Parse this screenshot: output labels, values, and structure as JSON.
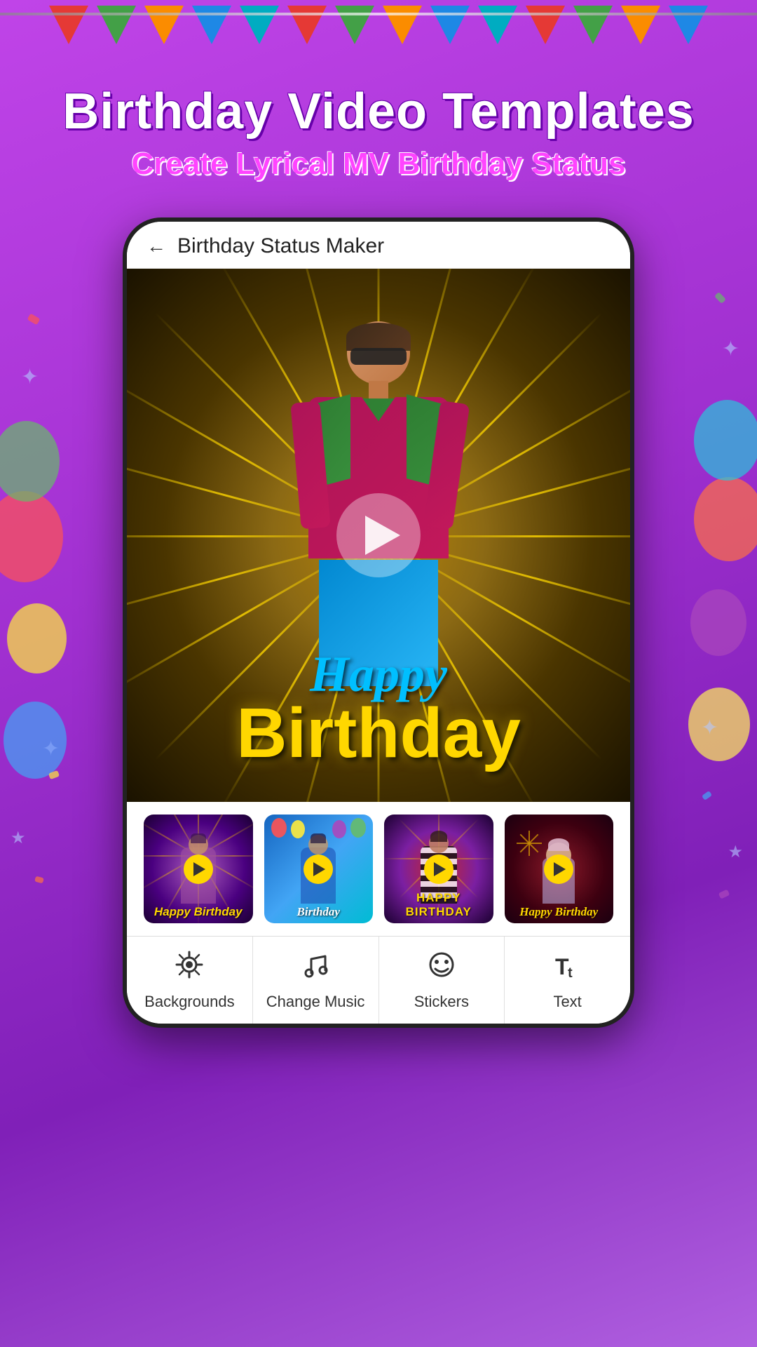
{
  "app": {
    "background_color": "#b040d8"
  },
  "header": {
    "title_line1": "Birthday Video Templates",
    "title_line2": "Create Lyrical MV Birthday Status"
  },
  "phone": {
    "topbar_title": "Birthday Status Maker",
    "back_label": "←"
  },
  "video": {
    "happy_text": "Happy",
    "birthday_text": "Birthday"
  },
  "thumbnails": [
    {
      "label": "Happy Birthday",
      "style": "dark-purple"
    },
    {
      "label": "Birthday",
      "style": "blue"
    },
    {
      "label": "HAPPY BIRTHDAY",
      "style": "red-purple"
    },
    {
      "label": "Happy Birthday",
      "style": "dark-red"
    }
  ],
  "toolbar": {
    "items": [
      {
        "id": "backgrounds",
        "label": "Backgrounds",
        "icon": "🎭"
      },
      {
        "id": "change-music",
        "label": "Change Music",
        "icon": "♪"
      },
      {
        "id": "stickers",
        "label": "Stickers",
        "icon": "☺"
      },
      {
        "id": "text",
        "label": "Text",
        "icon": "Tt"
      }
    ]
  },
  "bunting": {
    "colors": [
      "red",
      "green",
      "orange",
      "blue",
      "teal",
      "red",
      "green",
      "orange",
      "blue",
      "teal",
      "red",
      "green",
      "orange",
      "blue"
    ]
  }
}
